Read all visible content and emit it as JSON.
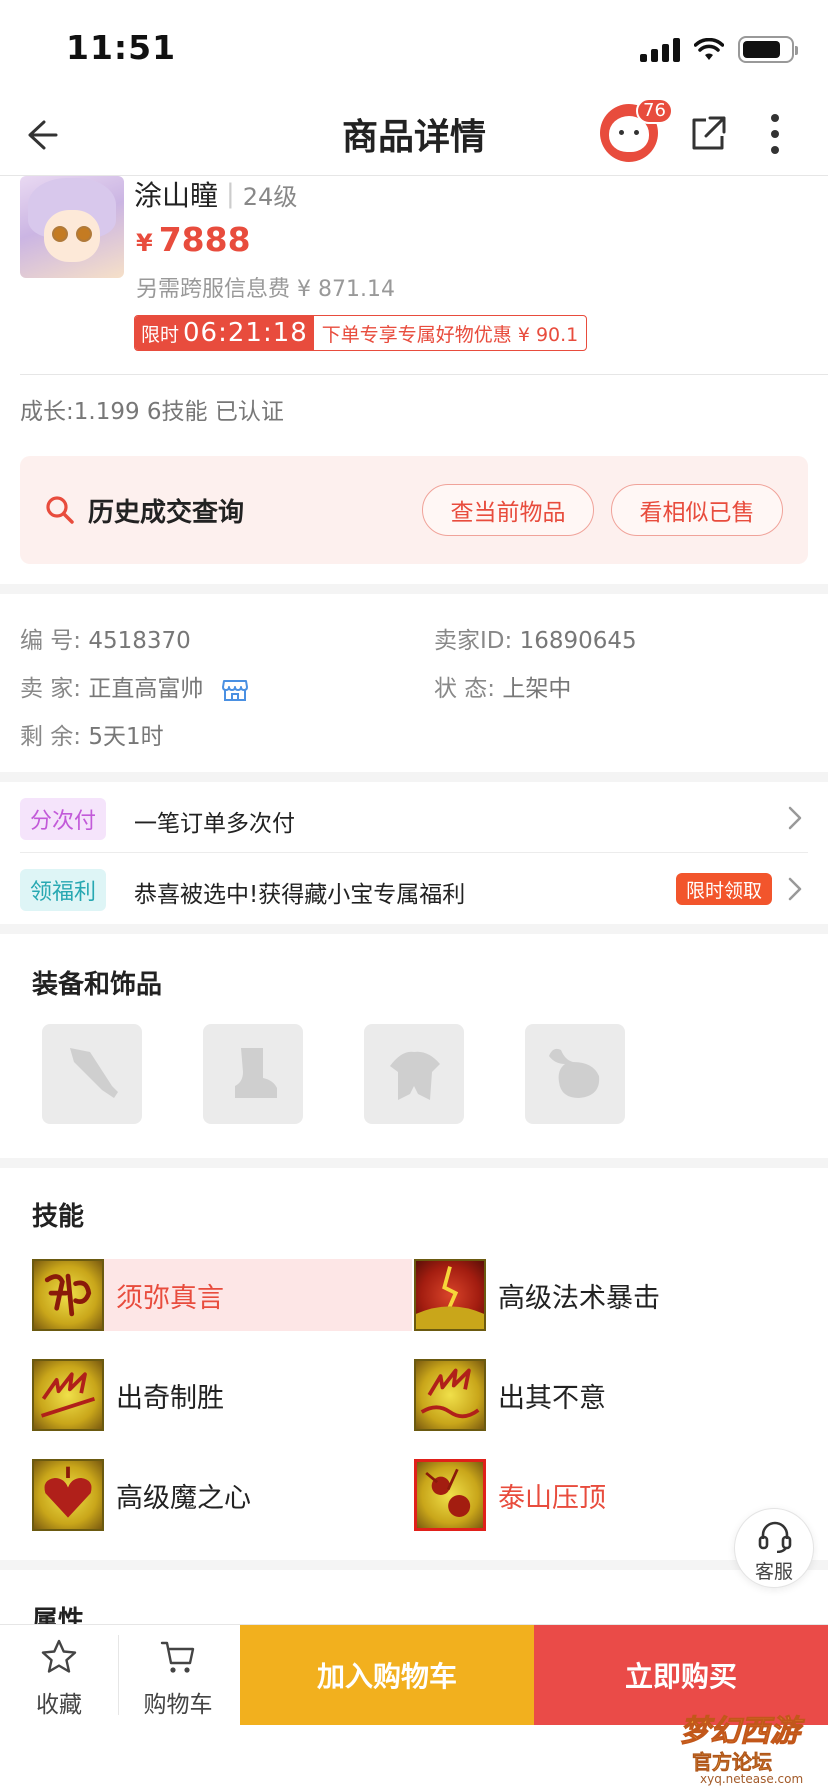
{
  "status_bar": {
    "time": "11:51"
  },
  "nav": {
    "title": "商品详情",
    "badge_count": "76"
  },
  "product": {
    "name": "涂山瞳",
    "level": "24级",
    "currency": "¥",
    "price": "7888",
    "fee": "另需跨服信息费 ¥ 871.14",
    "promo_label": "限时",
    "promo_time": "06:21:18",
    "promo_text": "下单专享专属好物优惠 ¥ 90.1",
    "growth": "成长:1.199 6技能 已认证"
  },
  "history": {
    "title": "历史成交查询",
    "btn_current": "查当前物品",
    "btn_similar": "看相似已售"
  },
  "info": {
    "id_label": "编 号:",
    "id_value": "4518370",
    "seller_id_label": "卖家ID:",
    "seller_id_value": "16890645",
    "seller_label": "卖 家:",
    "seller_value": "正直高富帅",
    "status_label": "状 态:",
    "status_value": "上架中",
    "remain_label": "剩 余:",
    "remain_value": "5天1时"
  },
  "services": [
    {
      "tag": "分次付",
      "text": "一笔订单多次付"
    },
    {
      "tag": "领福利",
      "text": "恭喜被选中!获得藏小宝专属福利",
      "badge": "限时领取"
    }
  ],
  "equipment": {
    "title": "装备和饰品",
    "slots": [
      "weapon-icon",
      "boot-icon",
      "armor-icon",
      "accessory-icon"
    ]
  },
  "skills": {
    "title": "技能",
    "items": [
      {
        "name": "须弥真言",
        "icon": "sumeru-skill-icon"
      },
      {
        "name": "高级法术暴击",
        "icon": "spell-crit-skill-icon"
      },
      {
        "name": "出奇制胜",
        "icon": "surprise-win-skill-icon"
      },
      {
        "name": "出其不意",
        "icon": "unexpected-skill-icon"
      },
      {
        "name": "高级魔之心",
        "icon": "demon-heart-skill-icon"
      },
      {
        "name": "泰山压顶",
        "icon": "taishan-skill-icon"
      }
    ]
  },
  "customer_service": {
    "label": "客服"
  },
  "next_section_title": "属性",
  "bottom_bar": {
    "favorite_label": "收藏",
    "cart_label": "购物车",
    "add_cart_label": "加入购物车",
    "buy_now_label": "立即购买"
  },
  "colors": {
    "accent_red": "#e84c3d",
    "cart_yellow": "#f2b01e",
    "buy_red": "#ea4b48"
  }
}
